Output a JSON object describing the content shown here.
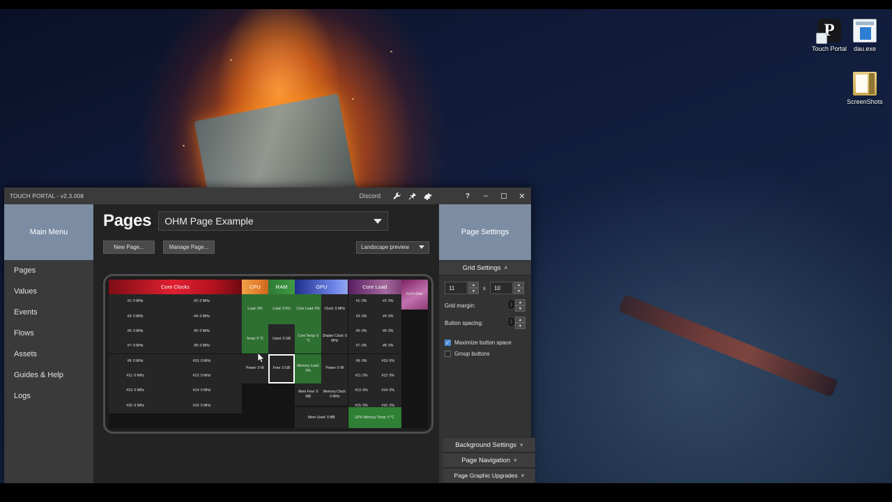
{
  "desktop": {
    "icons": [
      {
        "label": "Touch Portal",
        "icon": "touch-portal-shortcut-icon"
      },
      {
        "label": "dau.exe",
        "icon": "application-exe-icon"
      },
      {
        "label": "ScreenShots",
        "icon": "folder-icon"
      }
    ]
  },
  "window": {
    "title": "TOUCH PORTAL - v2.3.008",
    "titlebar": {
      "status_text": "Discord",
      "icons": [
        "wrench-icon",
        "plug-icon",
        "gear-icon"
      ],
      "help": "?",
      "minimize": "–",
      "maximize": "☐",
      "close": "✕"
    }
  },
  "nav": {
    "header": "Main Menu",
    "items": [
      {
        "label": "Pages"
      },
      {
        "label": "Values"
      },
      {
        "label": "Events"
      },
      {
        "label": "Flows"
      },
      {
        "label": "Assets"
      },
      {
        "label": "Guides & Help"
      },
      {
        "label": "Logs"
      }
    ]
  },
  "main": {
    "title": "Pages",
    "page_select": {
      "value": "OHM Page Example"
    },
    "new_page_label": "New Page...",
    "manage_page_label": "Manage Page...",
    "preview_mode": {
      "value": "Landscape preview"
    }
  },
  "page_settings": {
    "header": "Page Settings",
    "grid_section": {
      "title": "Grid Settings",
      "chevron": "˄"
    },
    "grid_cols": "11",
    "grid_x_label": "x",
    "grid_rows": "10",
    "grid_margin_label": "Grid margin:",
    "grid_margin": "0",
    "button_spacing_label": "Button spacing:",
    "button_spacing": "0",
    "maximize_label": "Maximize button space",
    "maximize_checked": "✓",
    "group_label": "Group buttons",
    "sections": [
      {
        "title": "Background Settings",
        "chevron": "˅"
      },
      {
        "title": "Page Navigation",
        "chevron": "˅"
      },
      {
        "title": "Page Graphic Upgrades",
        "chevron": "˅"
      }
    ]
  },
  "grid_preview": {
    "cols": 11,
    "rows": 10,
    "buttons": [
      {
        "text": "Core Clocks",
        "col": 0,
        "row": 0,
        "w": 5,
        "h": 1,
        "style": "hdr h-core",
        "name": "core-clocks-header"
      },
      {
        "text": "CPU",
        "col": 5,
        "row": 0,
        "w": 1,
        "h": 1,
        "style": "hdr h-cpu",
        "name": "cpu-header"
      },
      {
        "text": "RAM",
        "col": 6,
        "row": 0,
        "w": 1,
        "h": 1,
        "style": "hdr h-ram",
        "name": "ram-header"
      },
      {
        "text": "GPU",
        "col": 7,
        "row": 0,
        "w": 2,
        "h": 1,
        "style": "hdr h-gpu",
        "name": "gpu-header"
      },
      {
        "text": "Core Load",
        "col": 9,
        "row": 0,
        "w": 2,
        "h": 1,
        "style": "hdr h-load",
        "name": "core-load-header"
      },
      {
        "text": "GoTo Main",
        "col": 11,
        "row": 0,
        "w": 1,
        "h": 2,
        "style": "b-goto",
        "name": "goto-main-button"
      },
      {
        "text": "#1: 0 MHz",
        "col": 0,
        "row": 1,
        "w": 2,
        "h": 1,
        "style": "d",
        "name": "core-clock-1"
      },
      {
        "text": "#2: 0 MHz",
        "col": 2,
        "row": 1,
        "w": 3,
        "h": 1,
        "style": "d",
        "name": "core-clock-2"
      },
      {
        "text": "#3: 0 MHz",
        "col": 0,
        "row": 2,
        "w": 2,
        "h": 1,
        "style": "d",
        "name": "core-clock-3"
      },
      {
        "text": "#4: 0 MHz",
        "col": 2,
        "row": 2,
        "w": 3,
        "h": 1,
        "style": "d",
        "name": "core-clock-4"
      },
      {
        "text": "#5: 0 MHz",
        "col": 0,
        "row": 3,
        "w": 2,
        "h": 1,
        "style": "d",
        "name": "core-clock-5"
      },
      {
        "text": "#6: 0 MHz",
        "col": 2,
        "row": 3,
        "w": 3,
        "h": 1,
        "style": "d",
        "name": "core-clock-6"
      },
      {
        "text": "#7: 0 MHz",
        "col": 0,
        "row": 4,
        "w": 2,
        "h": 1,
        "style": "d",
        "name": "core-clock-7"
      },
      {
        "text": "#8: 0 MHz",
        "col": 2,
        "row": 4,
        "w": 3,
        "h": 1,
        "style": "d",
        "name": "core-clock-8"
      },
      {
        "text": "#9: 0 MHz",
        "col": 0,
        "row": 5,
        "w": 2,
        "h": 1,
        "style": "d",
        "name": "core-clock-9"
      },
      {
        "text": "#10: 0 MHz",
        "col": 2,
        "row": 5,
        "w": 3,
        "h": 1,
        "style": "d",
        "name": "core-clock-10"
      },
      {
        "text": "#11: 0 MHz",
        "col": 0,
        "row": 6,
        "w": 2,
        "h": 1,
        "style": "d",
        "name": "core-clock-11"
      },
      {
        "text": "#12: 0 MHz",
        "col": 2,
        "row": 6,
        "w": 3,
        "h": 1,
        "style": "d",
        "name": "core-clock-12"
      },
      {
        "text": "#13: 0 MHz",
        "col": 0,
        "row": 7,
        "w": 2,
        "h": 1,
        "style": "d",
        "name": "core-clock-13"
      },
      {
        "text": "#14: 0 MHz",
        "col": 2,
        "row": 7,
        "w": 3,
        "h": 1,
        "style": "d",
        "name": "core-clock-14"
      },
      {
        "text": "#15: 0 MHz",
        "col": 0,
        "row": 8,
        "w": 2,
        "h": 1,
        "style": "d",
        "name": "core-clock-15"
      },
      {
        "text": "#16: 0 MHz",
        "col": 2,
        "row": 8,
        "w": 3,
        "h": 1,
        "style": "d",
        "name": "core-clock-16"
      },
      {
        "text": "Load: 0%",
        "col": 5,
        "row": 1,
        "w": 1,
        "h": 2,
        "style": "g",
        "name": "cpu-load"
      },
      {
        "text": "Temp: 0 °C",
        "col": 5,
        "row": 3,
        "w": 1,
        "h": 2,
        "style": "g",
        "name": "cpu-temp"
      },
      {
        "text": "Power: 0 W",
        "col": 5,
        "row": 5,
        "w": 1,
        "h": 2,
        "style": "d",
        "name": "cpu-power"
      },
      {
        "text": "Load: 0.0%",
        "col": 6,
        "row": 1,
        "w": 1,
        "h": 2,
        "style": "g",
        "name": "ram-load"
      },
      {
        "text": "Used: 0 GB",
        "col": 6,
        "row": 3,
        "w": 1,
        "h": 2,
        "style": "d",
        "name": "ram-used"
      },
      {
        "text": "Free: 0 GB",
        "col": 6,
        "row": 5,
        "w": 1,
        "h": 2,
        "style": "sel",
        "name": "ram-free-selected"
      },
      {
        "text": "Core Load: 0%",
        "col": 7,
        "row": 1,
        "w": 1,
        "h": 2,
        "style": "g",
        "name": "gpu-core-load"
      },
      {
        "text": "Clock: 0 MHz",
        "col": 8,
        "row": 1,
        "w": 1,
        "h": 2,
        "style": "d",
        "name": "gpu-clock"
      },
      {
        "text": "Core Temp: 0 °C",
        "col": 7,
        "row": 3,
        "w": 1,
        "h": 2,
        "style": "g",
        "name": "gpu-core-temp"
      },
      {
        "text": "Shader Clock: 0 MHz",
        "col": 8,
        "row": 3,
        "w": 1,
        "h": 2,
        "style": "d",
        "name": "gpu-shader-clock"
      },
      {
        "text": "Memory Load: 0%",
        "col": 7,
        "row": 5,
        "w": 1,
        "h": 2,
        "style": "g",
        "name": "gpu-memory-load"
      },
      {
        "text": "Power: 0 W",
        "col": 8,
        "row": 5,
        "w": 1,
        "h": 2,
        "style": "d",
        "name": "gpu-power"
      },
      {
        "text": "Mem Free: 0 MB",
        "col": 7,
        "row": 7,
        "w": 1,
        "h": 1.5,
        "style": "d",
        "name": "gpu-mem-free"
      },
      {
        "text": "Memory Clock: 0 MHz",
        "col": 8,
        "row": 7,
        "w": 1,
        "h": 1.5,
        "style": "d",
        "name": "gpu-memory-clock"
      },
      {
        "text": "Mem Used: 0 MB",
        "col": 7,
        "row": 8.6,
        "w": 2,
        "h": 1.4,
        "style": "d",
        "name": "gpu-mem-used"
      },
      {
        "text": "GPU Memory Temp: 0 °C",
        "col": 9,
        "row": 8.6,
        "w": 2,
        "h": 1.4,
        "style": "b-gputemp",
        "name": "gpu-memory-temp"
      },
      {
        "text": "#1: 0%",
        "col": 9,
        "row": 1,
        "w": 1,
        "h": 1,
        "style": "d",
        "name": "core-load-1"
      },
      {
        "text": "#2: 0%",
        "col": 10,
        "row": 1,
        "w": 1,
        "h": 1,
        "style": "d",
        "name": "core-load-2"
      },
      {
        "text": "#3: 0%",
        "col": 9,
        "row": 2,
        "w": 1,
        "h": 1,
        "style": "d",
        "name": "core-load-3"
      },
      {
        "text": "#4: 0%",
        "col": 10,
        "row": 2,
        "w": 1,
        "h": 1,
        "style": "d",
        "name": "core-load-4"
      },
      {
        "text": "#5: 0%",
        "col": 9,
        "row": 3,
        "w": 1,
        "h": 1,
        "style": "d",
        "name": "core-load-5"
      },
      {
        "text": "#6: 0%",
        "col": 10,
        "row": 3,
        "w": 1,
        "h": 1,
        "style": "d",
        "name": "core-load-6"
      },
      {
        "text": "#7: 0%",
        "col": 9,
        "row": 4,
        "w": 1,
        "h": 1,
        "style": "d",
        "name": "core-load-7"
      },
      {
        "text": "#8: 0%",
        "col": 10,
        "row": 4,
        "w": 1,
        "h": 1,
        "style": "d",
        "name": "core-load-8"
      },
      {
        "text": "#9: 0%",
        "col": 9,
        "row": 5,
        "w": 1,
        "h": 1,
        "style": "d",
        "name": "core-load-9"
      },
      {
        "text": "#10: 0%",
        "col": 10,
        "row": 5,
        "w": 1,
        "h": 1,
        "style": "d",
        "name": "core-load-10"
      },
      {
        "text": "#11: 0%",
        "col": 9,
        "row": 6,
        "w": 1,
        "h": 1,
        "style": "d",
        "name": "core-load-11"
      },
      {
        "text": "#12: 0%",
        "col": 10,
        "row": 6,
        "w": 1,
        "h": 1,
        "style": "d",
        "name": "core-load-12"
      },
      {
        "text": "#13: 0%",
        "col": 9,
        "row": 7,
        "w": 1,
        "h": 1,
        "style": "d",
        "name": "core-load-13"
      },
      {
        "text": "#14: 0%",
        "col": 10,
        "row": 7,
        "w": 1,
        "h": 1,
        "style": "d",
        "name": "core-load-14"
      },
      {
        "text": "#15: 0%",
        "col": 9,
        "row": 8,
        "w": 1,
        "h": 1,
        "style": "d",
        "name": "core-load-15"
      },
      {
        "text": "#16: 0%",
        "col": 10,
        "row": 8,
        "w": 1,
        "h": 1,
        "style": "d",
        "name": "core-load-16"
      }
    ]
  }
}
